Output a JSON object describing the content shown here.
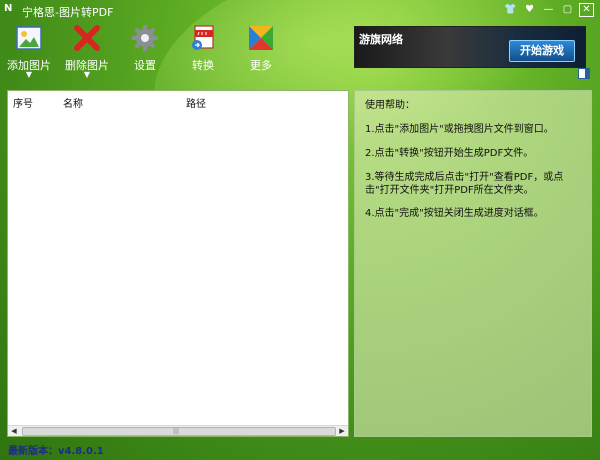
{
  "window": {
    "title": "宁格思-图片转PDF",
    "logo_text": "N",
    "controls": [
      {
        "name": "skin-icon",
        "glyph": "👕"
      },
      {
        "name": "menu-icon",
        "glyph": "♥"
      },
      {
        "name": "minimize-icon",
        "glyph": "—"
      },
      {
        "name": "maximize-icon",
        "glyph": "▢"
      },
      {
        "name": "close-icon",
        "glyph": "✕"
      }
    ]
  },
  "toolbar": {
    "add_image": "添加图片",
    "delete_image": "删除图片",
    "settings": "设置",
    "convert": "转换",
    "more": "更多",
    "dropdown_glyph": "▼"
  },
  "ad": {
    "logo": "游旗网络",
    "button": "开始游戏"
  },
  "list": {
    "columns": [
      "序号",
      "名称",
      "路径"
    ],
    "scroll_grip": "|||"
  },
  "help": {
    "title": "使用帮助：",
    "items": [
      "1.点击\"添加图片\"或拖拽图片文件到窗口。",
      "2.点击\"转换\"按钮开始生成PDF文件。",
      "3.等待生成完成后点击\"打开\"查看PDF，或点击\"打开文件夹\"打开PDF所在文件夹。",
      "4.点击\"完成\"按钮关闭生成进度对话框。"
    ]
  },
  "footer": {
    "version": "最新版本：v4.8.0.1"
  },
  "colors": {
    "accent_green": "#5fae24",
    "version_blue": "#1d2b8a"
  }
}
